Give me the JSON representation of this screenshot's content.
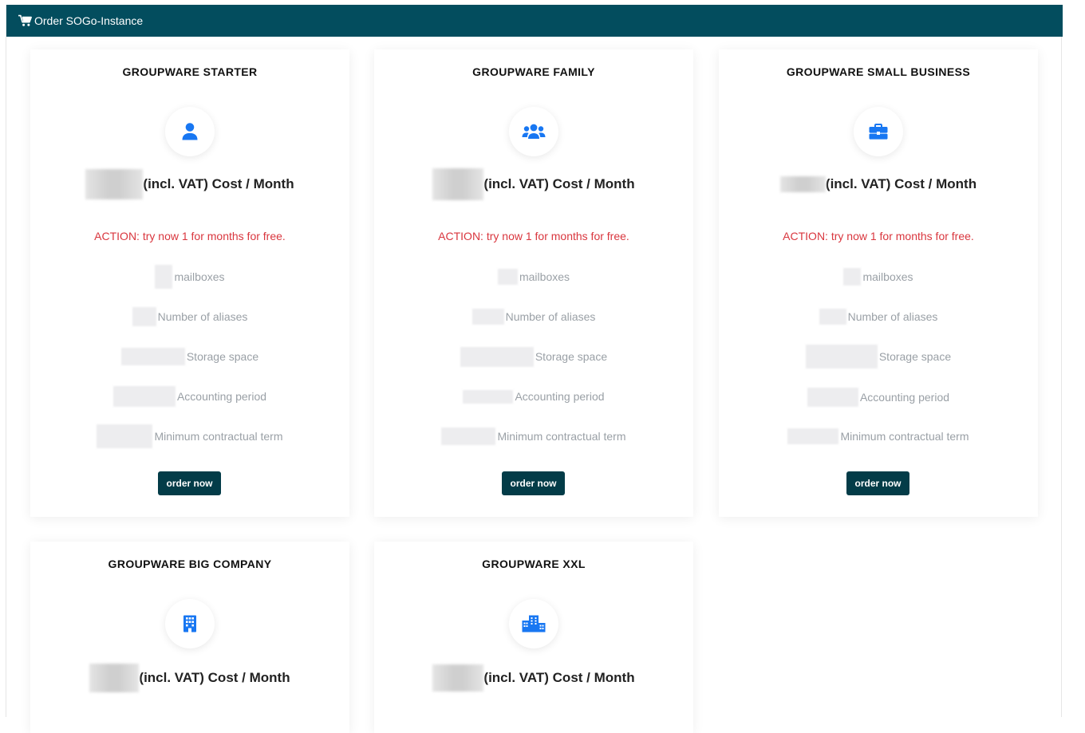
{
  "header": {
    "title": "Order SOGo-Instance",
    "icon": "cart-icon"
  },
  "accent_color": "#1877f2",
  "action_color": "#d9363e",
  "header_color": "#034d5e",
  "cards": [
    {
      "title": "GROUPWARE STARTER",
      "icon": "user-icon",
      "price_suffix": "(incl. VAT) Cost / Month",
      "action": "ACTION: try now 1 for months for free.",
      "features": [
        "mailboxes",
        "Number of aliases",
        "Storage space",
        "Accounting period",
        "Minimum contractual term"
      ],
      "button": "order now"
    },
    {
      "title": "GROUPWARE FAMILY",
      "icon": "users-group-icon",
      "price_suffix": "(incl. VAT) Cost / Month",
      "action": "ACTION: try now 1 for months for free.",
      "features": [
        "mailboxes",
        "Number of aliases",
        "Storage space",
        "Accounting period",
        "Minimum contractual term"
      ],
      "button": "order now"
    },
    {
      "title": "GROUPWARE SMALL BUSINESS",
      "icon": "briefcase-icon",
      "price_suffix": "(incl. VAT) Cost / Month",
      "action": "ACTION: try now 1 for months for free.",
      "features": [
        "mailboxes",
        "Number of aliases",
        "Storage space",
        "Accounting period",
        "Minimum contractual term"
      ],
      "button": "order now"
    },
    {
      "title": "GROUPWARE BIG COMPANY",
      "icon": "building-icon",
      "price_suffix": "(incl. VAT) Cost / Month"
    },
    {
      "title": "GROUPWARE XXL",
      "icon": "city-icon",
      "price_suffix": "(incl. VAT) Cost / Month"
    }
  ]
}
